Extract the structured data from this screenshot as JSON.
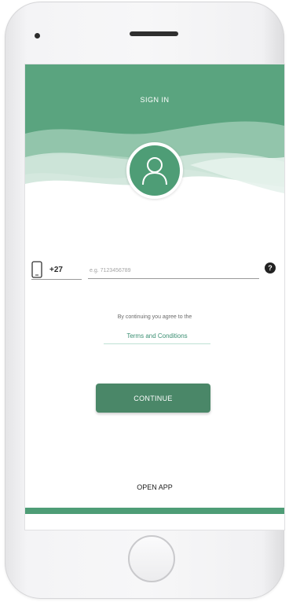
{
  "header": {
    "title": "SIGN IN"
  },
  "avatar": {
    "icon": "user-icon"
  },
  "phone_entry": {
    "device_icon": "mobile-phone-icon",
    "country_code": "+27",
    "placeholder": "e.g. 7123456789",
    "value": "",
    "help_icon": "help-icon",
    "help_symbol": "?"
  },
  "terms": {
    "agree_text": "By continuing you agree to the",
    "link_label": "Terms and Conditions"
  },
  "actions": {
    "continue_label": "CONTINUE",
    "open_app_label": "OPEN APP"
  },
  "colors": {
    "primary": "#4e9d76",
    "button": "#4a8768",
    "link": "#3a8f72"
  }
}
